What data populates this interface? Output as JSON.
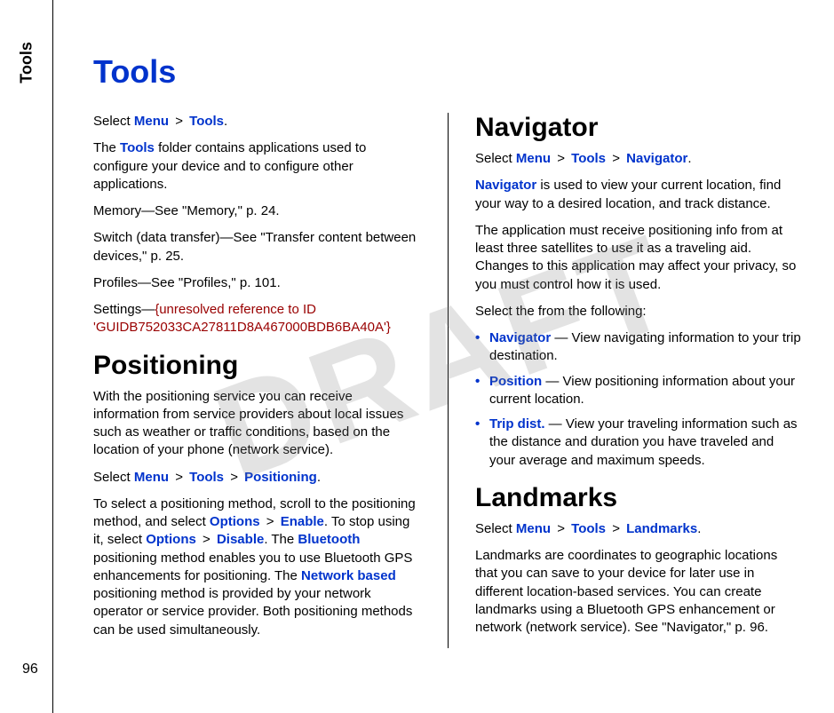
{
  "sidebar": {
    "label": "Tools",
    "pageNumber": "96"
  },
  "watermark": "DRAFT",
  "mainTitle": "Tools",
  "intro": {
    "p1_prefix": "Select ",
    "menu": "Menu",
    "tools": "Tools",
    "p1_suffix": ".",
    "p2_prefix": "The ",
    "p2_link": "Tools",
    "p2_suffix": " folder contains applications used to configure your device and to configure other applications.",
    "p3": "Memory—See \"Memory,\" p. 24.",
    "p4": "Switch (data transfer)—See \"Transfer content between devices,\" p. 25.",
    "p5": "Profiles—See \"Profiles,\" p. 101.",
    "p6_prefix": "Settings—",
    "p6_unresolved": "{unresolved reference to ID 'GUIDB752033CA27811D8A467000BDB6BA40A'}"
  },
  "positioning": {
    "title": "Positioning",
    "p1": "With the positioning service you can receive information from service providers about local issues such as weather or traffic conditions, based on the location of your phone (network service).",
    "p2_prefix": "Select ",
    "menu": "Menu",
    "tools": "Tools",
    "positioning": "Positioning",
    "p2_suffix": ".",
    "p3_part1": "To select a positioning method, scroll to the positioning method, and select ",
    "options": "Options",
    "enable": "Enable",
    "p3_part2": ". To stop using it, select ",
    "disable": "Disable",
    "p3_part3": ". The ",
    "bluetooth": "Bluetooth",
    "p3_part4": " positioning method enables you to use Bluetooth GPS enhancements for positioning. The ",
    "networkBased": "Network based",
    "p3_part5": " positioning method is provided by your network operator or service provider. Both positioning methods can be used simultaneously."
  },
  "navigator": {
    "title": "Navigator",
    "p1_prefix": "Select ",
    "menu": "Menu",
    "tools": "Tools",
    "navigator": "Navigator",
    "p1_suffix": ".",
    "p2_link": "Navigator",
    "p2_text": " is used to view your current location, find your way to a desired location, and track distance.",
    "p3": "The application must receive positioning info from at least three satellites to use it as a traveling aid. Changes to this application may affect your privacy, so you must control how it is used.",
    "p4": "Select the from the following:",
    "items": [
      {
        "label": "Navigator",
        "text": " — View navigating information to your trip destination."
      },
      {
        "label": "Position",
        "text": " — View positioning information about your current location."
      },
      {
        "label": "Trip dist.",
        "text": " — View your traveling information such as the distance and duration you have traveled and your average and maximum speeds."
      }
    ]
  },
  "landmarks": {
    "title": "Landmarks",
    "p1_prefix": "Select ",
    "menu": "Menu",
    "tools": "Tools",
    "landmarks": "Landmarks",
    "p1_suffix": ".",
    "p2": "Landmarks are coordinates to geographic locations that you can save to your device for later use in different location-based services. You can create landmarks using a Bluetooth GPS enhancement or network (network service). See \"Navigator,\" p. 96."
  }
}
